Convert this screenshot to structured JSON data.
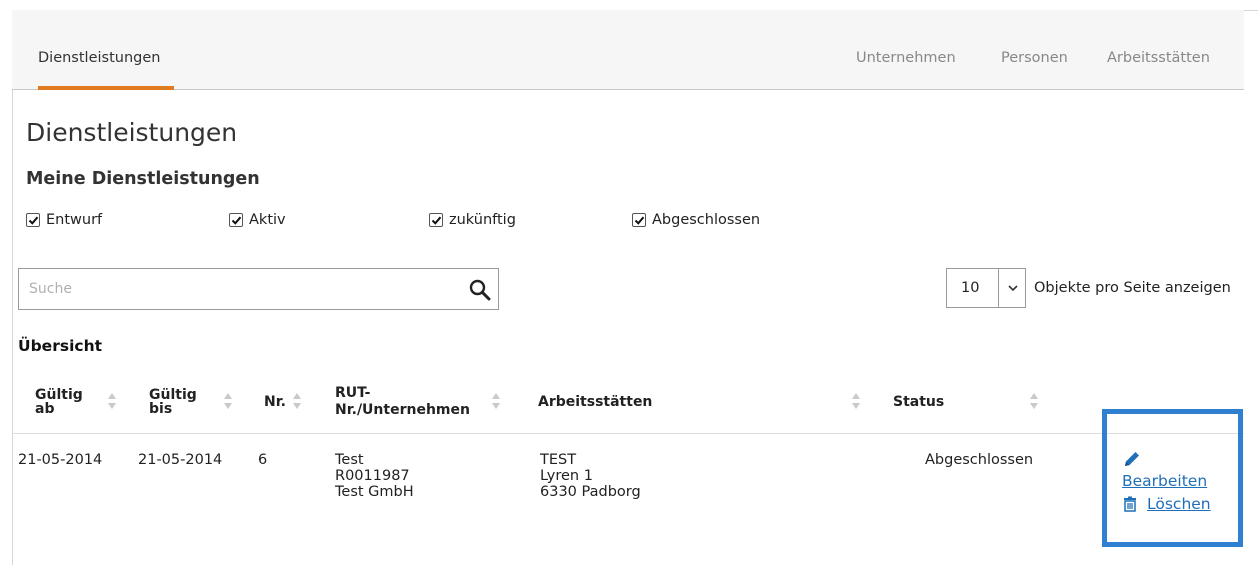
{
  "tabs": {
    "active": "Dienstleistungen",
    "others": [
      "Unternehmen",
      "Personen",
      "Arbeitsstätten"
    ]
  },
  "page_title": "Dienstleistungen",
  "section_title": "Meine Dienstleistungen",
  "filters": [
    {
      "label": "Entwurf",
      "checked": true
    },
    {
      "label": "Aktiv",
      "checked": true
    },
    {
      "label": "zukünftig",
      "checked": true
    },
    {
      "label": "Abgeschlossen",
      "checked": true
    }
  ],
  "search": {
    "placeholder": "Suche"
  },
  "page_size": {
    "value": "10",
    "label": "Objekte pro Seite anzeigen"
  },
  "overview_title": "Übersicht",
  "table": {
    "headers": {
      "valid_from_1": "Gültig",
      "valid_from_2": "ab",
      "valid_to_1": "Gültig",
      "valid_to_2": "bis",
      "nr": "Nr.",
      "rut_1": "RUT-",
      "rut_2": "Nr./Unternehmen",
      "worksites": "Arbeitsstätten",
      "status": "Status"
    },
    "rows": [
      {
        "valid_from": "21-05-2014",
        "valid_to": "21-05-2014",
        "nr": "6",
        "rut_lines": [
          "Test",
          "R0011987",
          "Test GmbH"
        ],
        "worksite_lines": [
          "TEST",
          "Lyren 1",
          "6330 Padborg"
        ],
        "status": "Abgeschlossen",
        "actions": {
          "edit": "Bearbeiten",
          "delete": "Löschen"
        }
      }
    ]
  },
  "colors": {
    "accent": "#e07b1f",
    "link": "#1f6fb8",
    "highlight": "#2f80d0"
  }
}
